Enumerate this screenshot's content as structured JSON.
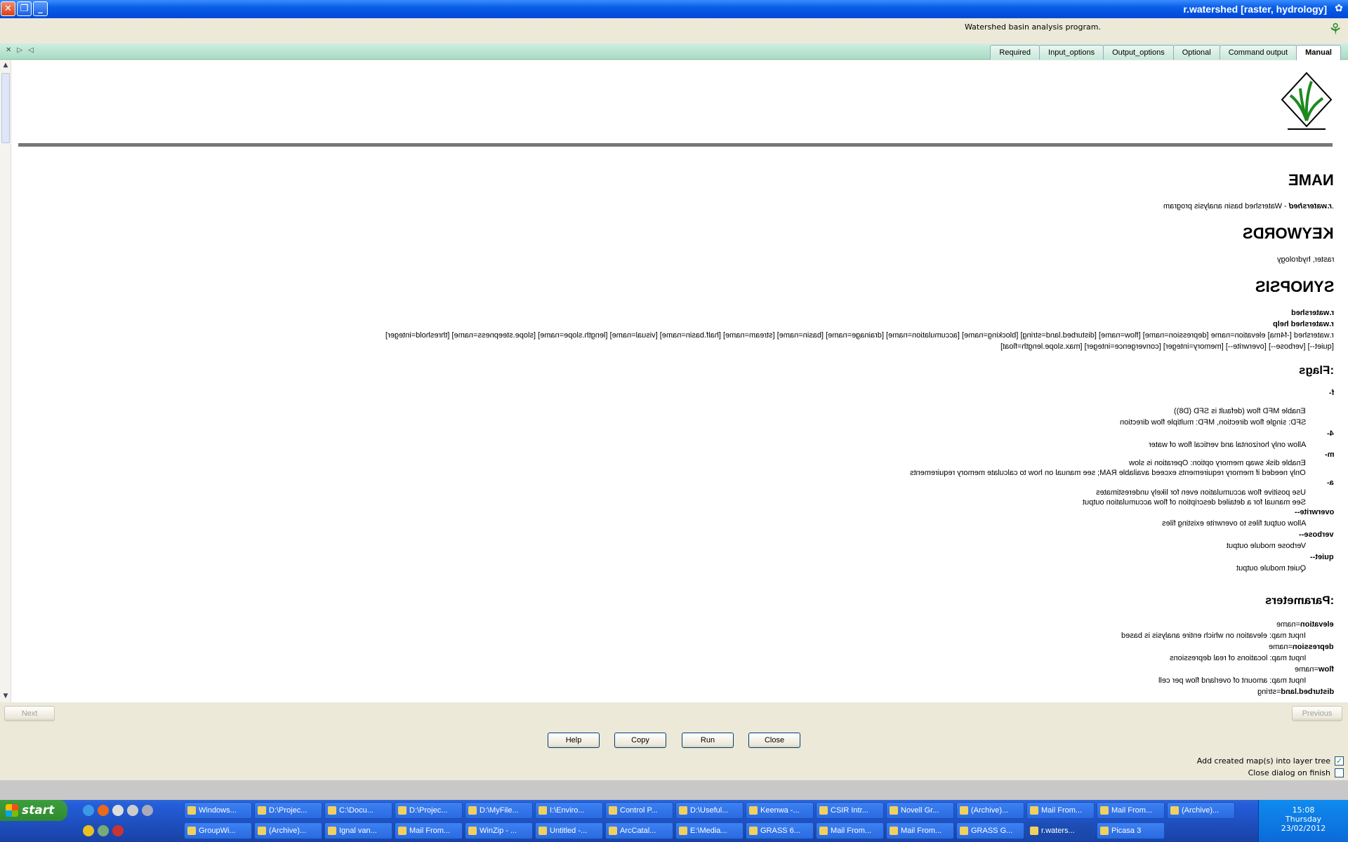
{
  "window": {
    "title": "r.watershed [raster, hydrology]",
    "description": "Watershed basin analysis program.",
    "icon": "grass-icon"
  },
  "tabs": [
    {
      "label": "Manual",
      "active": true
    },
    {
      "label": "Command output",
      "active": false
    },
    {
      "label": "Optional",
      "active": false
    },
    {
      "label": "Output_options",
      "active": false
    },
    {
      "label": "Input_options",
      "active": false
    },
    {
      "label": "Required",
      "active": false
    }
  ],
  "manual": {
    "name_heading": "NAME",
    "name_cmd": "r.watershed",
    "name_desc": " - Watershed basin analysis program.",
    "keywords_heading": "KEYWORDS",
    "keywords_text": "raster, hydrology",
    "synopsis_heading": "SYNOPSIS",
    "syn1": "r.watershed",
    "syn2": "r.watershed help",
    "syn3": "r.watershed [-f4ma] elevation=name [depression=name] [flow=name] [disturbed.land=string] [blocking=name] [accumulation=name] [drainage=name] [basin=name] [stream=name] [half.basin=name] [visual=name] [length.slope=name] [slope.steepness=name] [threshold=integer]",
    "syn4": "[max.slope.length=float] [convergence=integer] [memory=integer] [--overwrite] [--verbose] [--quiet]",
    "flags_heading": "Flags:",
    "flags": [
      {
        "flag": "-f",
        "lines": [
          "Enable MFD flow (default is SFD (D8))",
          "SFD: single flow direction, MFD: multiple flow direction"
        ]
      },
      {
        "flag": "-4",
        "lines": [
          "Allow only horizontal and vertical flow of water"
        ]
      },
      {
        "flag": "-m",
        "lines": [
          "Enable disk swap memory option: Operation is slow",
          "Only needed if memory requirements exceed available RAM; see manual on how to calculate memory requirements"
        ]
      },
      {
        "flag": "-a",
        "lines": [
          "Use positive flow accumulation even for likely underestimates",
          "See manual for a detailed description of flow accumulation output"
        ]
      },
      {
        "flag": "--overwrite",
        "lines": [
          "Allow output files to overwrite existing files"
        ]
      },
      {
        "flag": "--verbose",
        "lines": [
          "Verbose module output"
        ]
      },
      {
        "flag": "--quiet",
        "lines": [
          "Quiet module output"
        ]
      }
    ],
    "params_heading": "Parameters:",
    "params": [
      {
        "name": "elevation",
        "type": "=name",
        "desc": "Input map: elevation on which entire analysis is based"
      },
      {
        "name": "depression",
        "type": "=name",
        "desc": "Input map: locations of real depressions"
      },
      {
        "name": "flow",
        "type": "=name",
        "desc": "Input map: amount of overland flow per cell"
      },
      {
        "name": "disturbed.land",
        "type": "=string",
        "desc": ""
      }
    ]
  },
  "buttons": {
    "next": "Next",
    "previous": "Previous",
    "help": "Help",
    "copy": "Copy",
    "run": "Run",
    "close": "Close"
  },
  "options": {
    "add_maps_label": "Add created map(s) into layer tree",
    "add_maps_checked": true,
    "close_on_finish_label": "Close dialog on finish",
    "close_on_finish_checked": false
  },
  "taskbar": {
    "start_label": "start",
    "row1": [
      "Windows...",
      "D:\\Projec...",
      "C:\\Docu...",
      "D:\\Projec...",
      "D:\\MyFile...",
      "I:\\Enviro...",
      "Control P...",
      "D:\\Useful...",
      "Keenwa -...",
      "CSIR Intr...",
      "Novell Gr...",
      "(Archive)...",
      "Mail From...",
      "Mail From...",
      "(Archive)..."
    ],
    "row2": [
      "GroupWi...",
      "(Archive)...",
      "Ignal van...",
      "Mail From...",
      "WinZip - ...",
      "Untitled -...",
      "ArcCatal...",
      "E:\\Media...",
      "GRASS 6...",
      "Mail From...",
      "Mail From...",
      "GRASS G...",
      "r.waters...",
      "Picasa 3"
    ],
    "clock": "15:08",
    "day": "Thursday",
    "date": "23/02/2012"
  }
}
